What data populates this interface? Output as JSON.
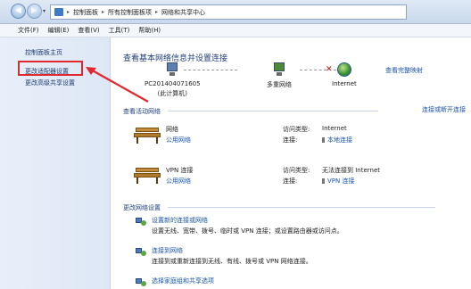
{
  "address_bar": {
    "crumbs": [
      "控制面板",
      "所有控制面板项",
      "网络和共享中心"
    ]
  },
  "menu": [
    "文件(F)",
    "编辑(E)",
    "查看(V)",
    "工具(T)",
    "帮助(H)"
  ],
  "sidebar": {
    "items": [
      {
        "label": "控制面板主页"
      },
      {
        "label": "更改适配器设置"
      },
      {
        "label": "更改高级共享设置"
      }
    ]
  },
  "main": {
    "heading": "查看基本网络信息并设置连接",
    "full_map_link": "查看完整映射",
    "map": {
      "computer_label_1": "PC201404071605",
      "computer_label_2": "(此计算机)",
      "middle_label": "多重网络",
      "internet_label": "Internet"
    },
    "active_networks_title": "查看活动网络",
    "connect_disconnect_link": "连接或断开连接",
    "networks": [
      {
        "name": "网络",
        "type": "公用网络",
        "access_key": "访问类型:",
        "access_value": "Internet",
        "conn_key": "连接:",
        "conn_value": "本地连接"
      },
      {
        "name": "VPN 连接",
        "type": "公用网络",
        "access_key": "访问类型:",
        "access_value": "无法连接到 Internet",
        "conn_key": "连接:",
        "conn_value": "VPN 连接"
      }
    ],
    "change_settings_title": "更改网络设置",
    "tasks": [
      {
        "title": "设置新的连接或网络",
        "desc": "设置无线、宽带、拨号、临时或 VPN 连接；或设置路由器或访问点。"
      },
      {
        "title": "连接到网络",
        "desc": "连接到或重新连接到无线、有线、拨号或 VPN 网络连接。"
      },
      {
        "title": "选择家庭组和共享选项",
        "desc": ""
      }
    ]
  },
  "colors": {
    "annotation_red": "#e0282e",
    "link_blue": "#1a55a8"
  }
}
